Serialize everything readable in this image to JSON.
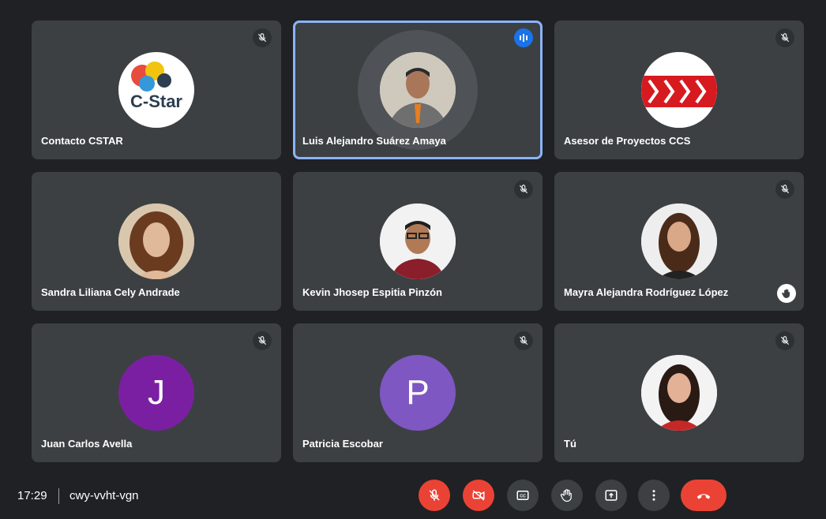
{
  "meeting": {
    "time": "17:29",
    "code": "cwy-vvht-vgn"
  },
  "participants": [
    {
      "name": "Contacto CSTAR",
      "muted": true,
      "avatar": "C-Star logo",
      "logo_text": "C-Star"
    },
    {
      "name": "Luis Alejandro Suárez Amaya",
      "speaking": true,
      "avatar": "photo"
    },
    {
      "name": "Asesor de Proyectos CCS",
      "muted": true,
      "avatar": "CCS logo"
    },
    {
      "name": "Sandra Liliana Cely Andrade",
      "avatar": "photo"
    },
    {
      "name": "Kevin Jhosep Espitia Pinzón",
      "muted": true,
      "avatar": "photo"
    },
    {
      "name": "Mayra Alejandra Rodríguez López",
      "muted": true,
      "hand_raised": true,
      "avatar": "photo"
    },
    {
      "name": "Juan Carlos Avella",
      "muted": true,
      "avatar_letter": "J",
      "avatar_color": "#7b1fa2"
    },
    {
      "name": "Patricia Escobar",
      "muted": true,
      "avatar_letter": "P",
      "avatar_color": "#7e57c2"
    },
    {
      "name": "Tú",
      "muted": true,
      "avatar": "photo"
    }
  ],
  "controls": [
    "mic-off",
    "camera-off",
    "captions",
    "raise-hand",
    "present",
    "more-options",
    "leave-call"
  ],
  "colors": {
    "background": "#202124",
    "tile": "#3c4043",
    "active_border": "#8ab4f8",
    "danger": "#ea4335",
    "speaking": "#1a73e8"
  }
}
